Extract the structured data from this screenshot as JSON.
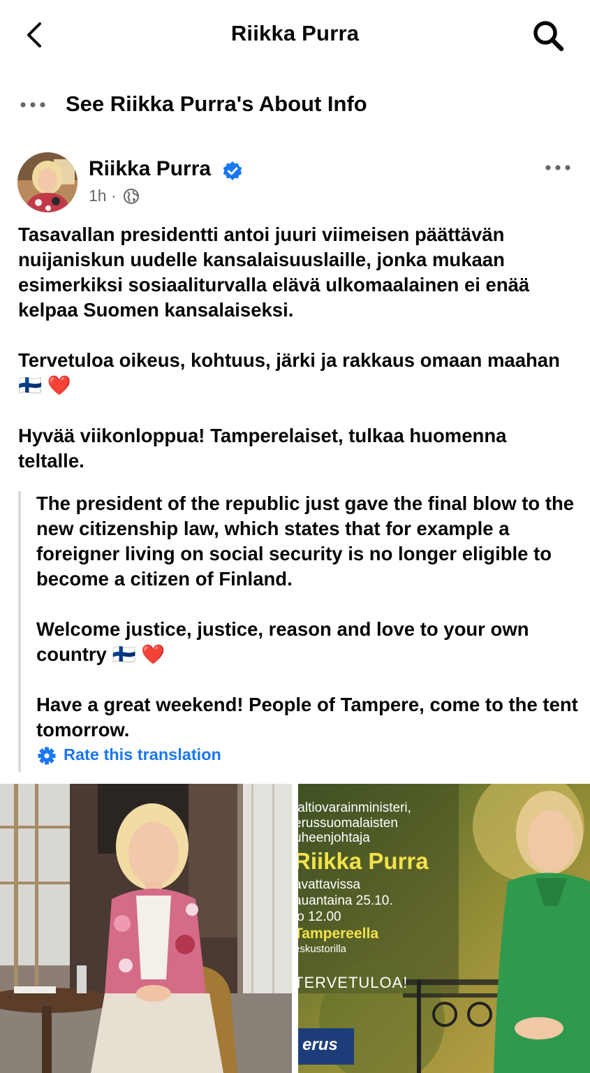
{
  "header": {
    "title": "Riikka Purra"
  },
  "about": {
    "label": "See Riikka Purra's About Info"
  },
  "post": {
    "author": "Riikka Purra",
    "time": "1h ·",
    "paragraphs": [
      "Tasavallan presidentti antoi juuri viimeisen päättävän nuijaniskun uudelle kansalaisuuslaille, jonka mukaan esimerkiksi sosiaaliturvalla elävä ulkomaalainen ei enää kelpaa Suomen kansalaiseksi.",
      "Tervetuloa oikeus, kohtuus, järki ja rakkaus omaan maahan 🇫🇮 ❤️",
      "Hyvää viikonloppua! Tamperelaiset, tulkaa huomenna teltalle."
    ],
    "translation": [
      "The president of the republic just gave the final blow to the new citizenship law, which states that for example a foreigner living on social security is no longer eligible to become a citizen of Finland.",
      "Welcome justice, justice, reason and love to your own country 🇫🇮 ❤️",
      "Have a great weekend! People of Tampere, come to the tent tomorrow."
    ],
    "rate_label": "Rate this translation"
  },
  "poster": {
    "line1": "/altiovarainministeri,",
    "line2": "erussuomalaisten",
    "line3": "uheenjohtaja",
    "name": "Riikka Purra",
    "line5": "avattavissa",
    "line6": "auantaina 25.10.",
    "line7": "lo 12.00",
    "place": "Tampereella",
    "line9": "eskustorilla",
    "welcome": "TERVETULOA!",
    "logo": "erus"
  },
  "colors": {
    "accent": "#1877f2",
    "secondary_text": "#65676b",
    "quote_border": "#d8dadf"
  },
  "icons": {
    "back": "chevron-left-icon",
    "search": "search-icon",
    "more": "more-horizontal-icon",
    "verified": "verified-badge-icon",
    "audience": "globe-icon",
    "settings": "gear-icon"
  }
}
